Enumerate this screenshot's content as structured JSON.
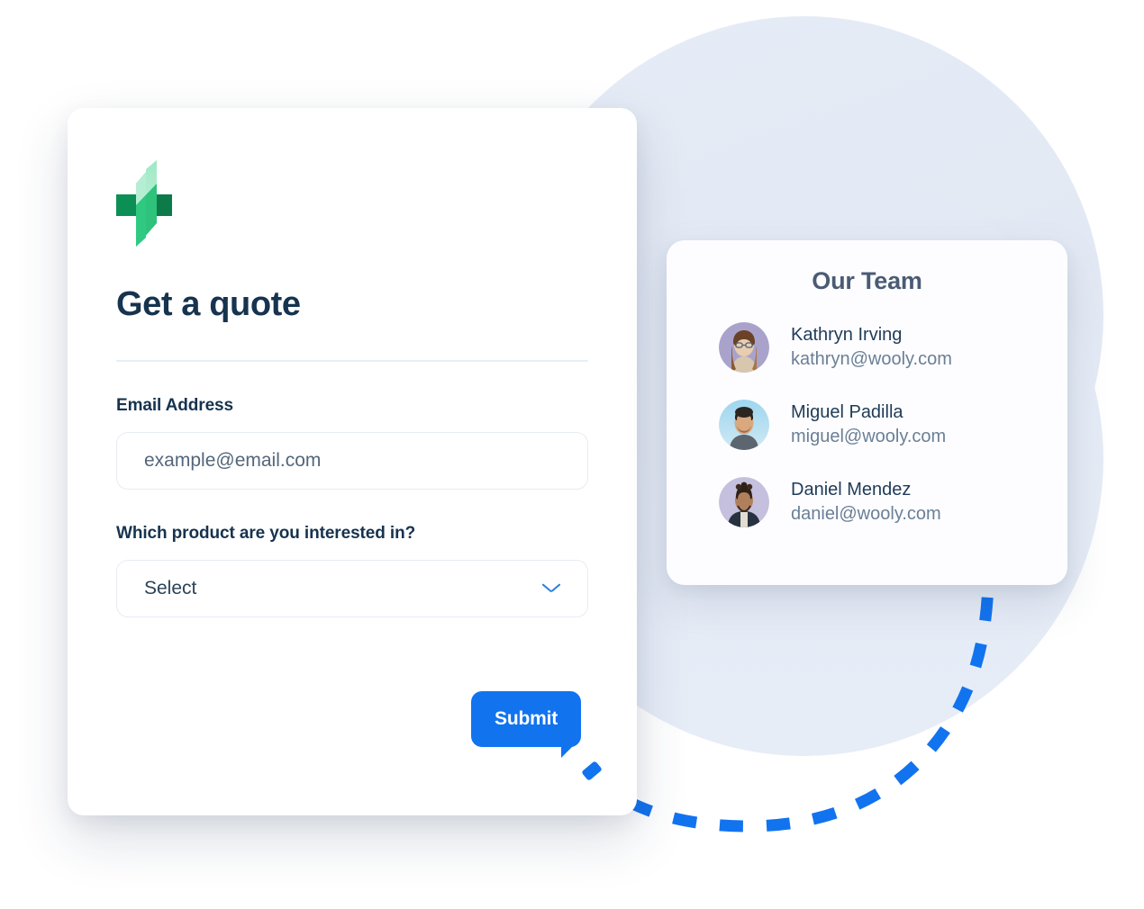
{
  "quote_card": {
    "logo_name": "wooly-bolt-logo",
    "title": "Get a quote",
    "email_field": {
      "label": "Email Address",
      "placeholder": "example@email.com",
      "value": ""
    },
    "product_field": {
      "label": "Which product are you interested in?",
      "selected": "Select",
      "chevron_icon": "chevron-down-icon"
    },
    "submit_label": "Submit"
  },
  "team_card": {
    "title": "Our Team",
    "members": [
      {
        "name": "Kathryn Irving",
        "email": "kathryn@wooly.com",
        "avatar_bg": "#a9a3cc"
      },
      {
        "name": "Miguel Padilla",
        "email": "miguel@wooly.com",
        "avatar_bg": "#a8d8ef"
      },
      {
        "name": "Daniel Mendez",
        "email": "daniel@wooly.com",
        "avatar_bg": "#c4c0dd"
      }
    ]
  },
  "colors": {
    "accent_blue": "#1273ef",
    "heading_navy": "#16334f",
    "logo_green": "#21b573",
    "bg_circle": "#e4eaf5",
    "divider": "#e8eef5"
  },
  "decor": {
    "dashed_curve_name": "dashed-connector-curve",
    "background_circle_name": "background-circle"
  }
}
